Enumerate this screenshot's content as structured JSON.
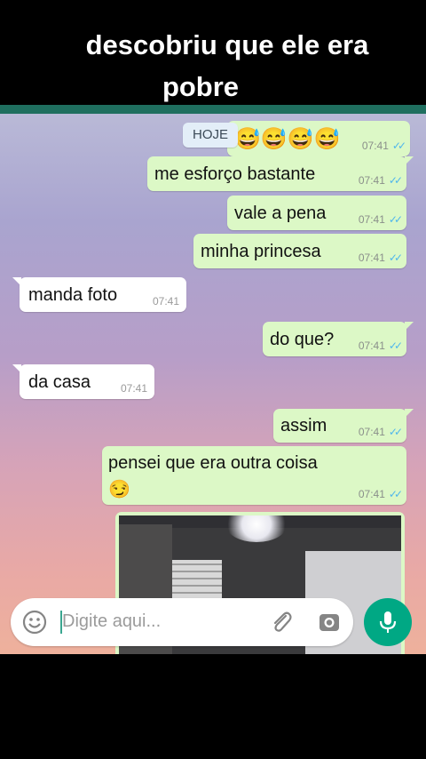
{
  "caption": {
    "line1": "descobriu que ele era",
    "line2": "pobre"
  },
  "chat": {
    "date_chip": "HOJE",
    "messages": [
      {
        "dir": "out",
        "text": "😅😅😅😅",
        "time": "07:41"
      },
      {
        "dir": "out",
        "text": "me esforço bastante",
        "time": "07:41"
      },
      {
        "dir": "out",
        "text": "vale a pena",
        "time": "07:41"
      },
      {
        "dir": "out",
        "text": "minha princesa",
        "time": "07:41"
      },
      {
        "dir": "in",
        "text": "manda foto",
        "time": "07:41"
      },
      {
        "dir": "out",
        "text": "do que?",
        "time": "07:41"
      },
      {
        "dir": "in",
        "text": "da casa",
        "time": "07:41"
      },
      {
        "dir": "out",
        "text": "assim",
        "time": "07:41"
      },
      {
        "dir": "out",
        "text": "pensei que era outra coisa",
        "emoji": "😏",
        "time": "07:41"
      }
    ],
    "photo_message": {
      "dir": "out",
      "content": "photo of a house interior"
    }
  },
  "composer": {
    "placeholder": "Digite aqui...",
    "icons": {
      "emoji": "smiley-icon",
      "attach": "paperclip-icon",
      "camera": "camera-icon",
      "mic": "microphone-icon"
    }
  },
  "colors": {
    "outgoing_bubble": "#dcf8c6",
    "incoming_bubble": "#ffffff",
    "mic_button": "#00a884",
    "read_ticks": "#4fb6ec"
  }
}
